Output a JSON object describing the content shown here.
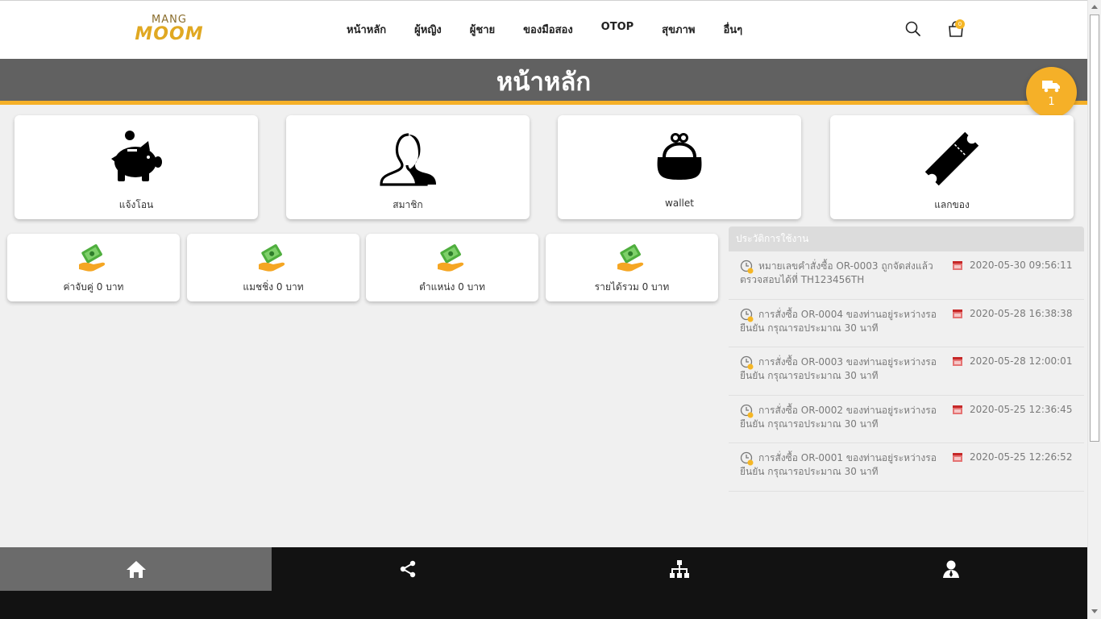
{
  "header": {
    "logo_top": "MANG",
    "logo_main": "MOOM",
    "nav": [
      "หน้าหลัก",
      "ผู้หญิง",
      "ผู้ชาย",
      "ของมือสอง",
      "OTOP",
      "สุขภาพ",
      "อื่นๆ"
    ],
    "cart_count": "0"
  },
  "title": "หน้าหลัก",
  "delivery": {
    "count": "1"
  },
  "cards": [
    {
      "label": "แจ้งโอน",
      "icon": "piggy-bank-icon"
    },
    {
      "label": "สมาชิก",
      "icon": "users-icon"
    },
    {
      "label": "wallet",
      "icon": "wallet-icon"
    },
    {
      "label": "แลกของ",
      "icon": "ticket-icon"
    }
  ],
  "money_cards": [
    {
      "label": "ค่าจับคู่ 0 บาท",
      "icon": "money-hand-icon"
    },
    {
      "label": "แมชชิ่ง 0 บาท",
      "icon": "money-hand-icon"
    },
    {
      "label": "ตำแหน่ง 0 บาท",
      "icon": "money-hand-icon"
    },
    {
      "label": "รายได้รวม 0 บาท",
      "icon": "money-hand-icon"
    }
  ],
  "history": {
    "title": "ประวัติการใช้งาน",
    "items": [
      {
        "text": "หมายเลขคำสั่งซื้อ OR-0003 ถูกจัดส่งแล้วตรวจสอบได้ที่ TH123456TH",
        "date": "2020-05-30 09:56:11"
      },
      {
        "text": "การสั่งซื้อ OR-0004 ของท่านอยู่ระหว่างรอยืนยัน กรุณารอประมาณ 30 นาที",
        "date": "2020-05-28 16:38:38"
      },
      {
        "text": "การสั่งซื้อ OR-0003 ของท่านอยู่ระหว่างรอยืนยัน กรุณารอประมาณ 30 นาที",
        "date": "2020-05-28 12:00:01"
      },
      {
        "text": "การสั่งซื้อ OR-0002 ของท่านอยู่ระหว่างรอยืนยัน กรุณารอประมาณ 30 นาที",
        "date": "2020-05-25 12:36:45"
      },
      {
        "text": "การสั่งซื้อ OR-0001 ของท่านอยู่ระหว่างรอยืนยัน กรุณารอประมาณ 30 นาที",
        "date": "2020-05-25 12:26:52"
      }
    ]
  },
  "bottom_nav": [
    {
      "icon": "home-icon",
      "active": true
    },
    {
      "icon": "share-icon",
      "active": false
    },
    {
      "icon": "sitemap-icon",
      "active": false
    },
    {
      "icon": "user-icon",
      "active": false
    }
  ],
  "colors": {
    "accent": "#f5b028",
    "title_bar": "#616161",
    "bottom_bar": "#121212"
  }
}
